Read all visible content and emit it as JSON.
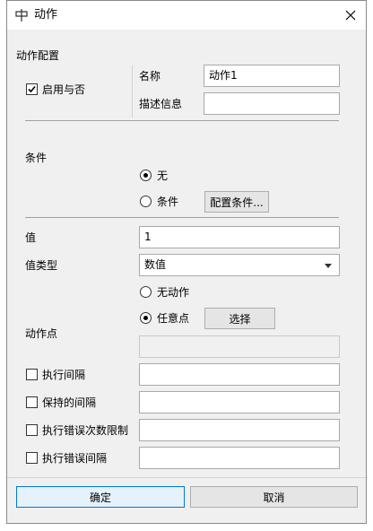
{
  "window": {
    "title": "动作"
  },
  "section": {
    "config_title": "动作配置"
  },
  "enable": {
    "label": "启用与否",
    "checked": true
  },
  "name": {
    "label": "名称",
    "value": "动作1"
  },
  "description": {
    "label": "描述信息",
    "value": ""
  },
  "condition": {
    "label": "条件",
    "option_none": "无",
    "option_condition": "条件",
    "configure_button": "配置条件..."
  },
  "value": {
    "label": "值",
    "value": "1"
  },
  "value_type": {
    "label": "值类型",
    "selected": "数值"
  },
  "action_point": {
    "label": "动作点",
    "option_none": "无动作",
    "option_any": "任意点",
    "select_button": "选择",
    "value": ""
  },
  "exec_interval": {
    "label": "执行间隔",
    "value": ""
  },
  "hold_interval": {
    "label": "保持的间隔",
    "value": ""
  },
  "error_limit": {
    "label": "执行错误次数限制",
    "value": ""
  },
  "error_interval": {
    "label": "执行错误间隔",
    "value": ""
  },
  "footer": {
    "ok": "确定",
    "cancel": "取消"
  },
  "icons": {
    "title": "app-icon",
    "close": "close-icon"
  }
}
